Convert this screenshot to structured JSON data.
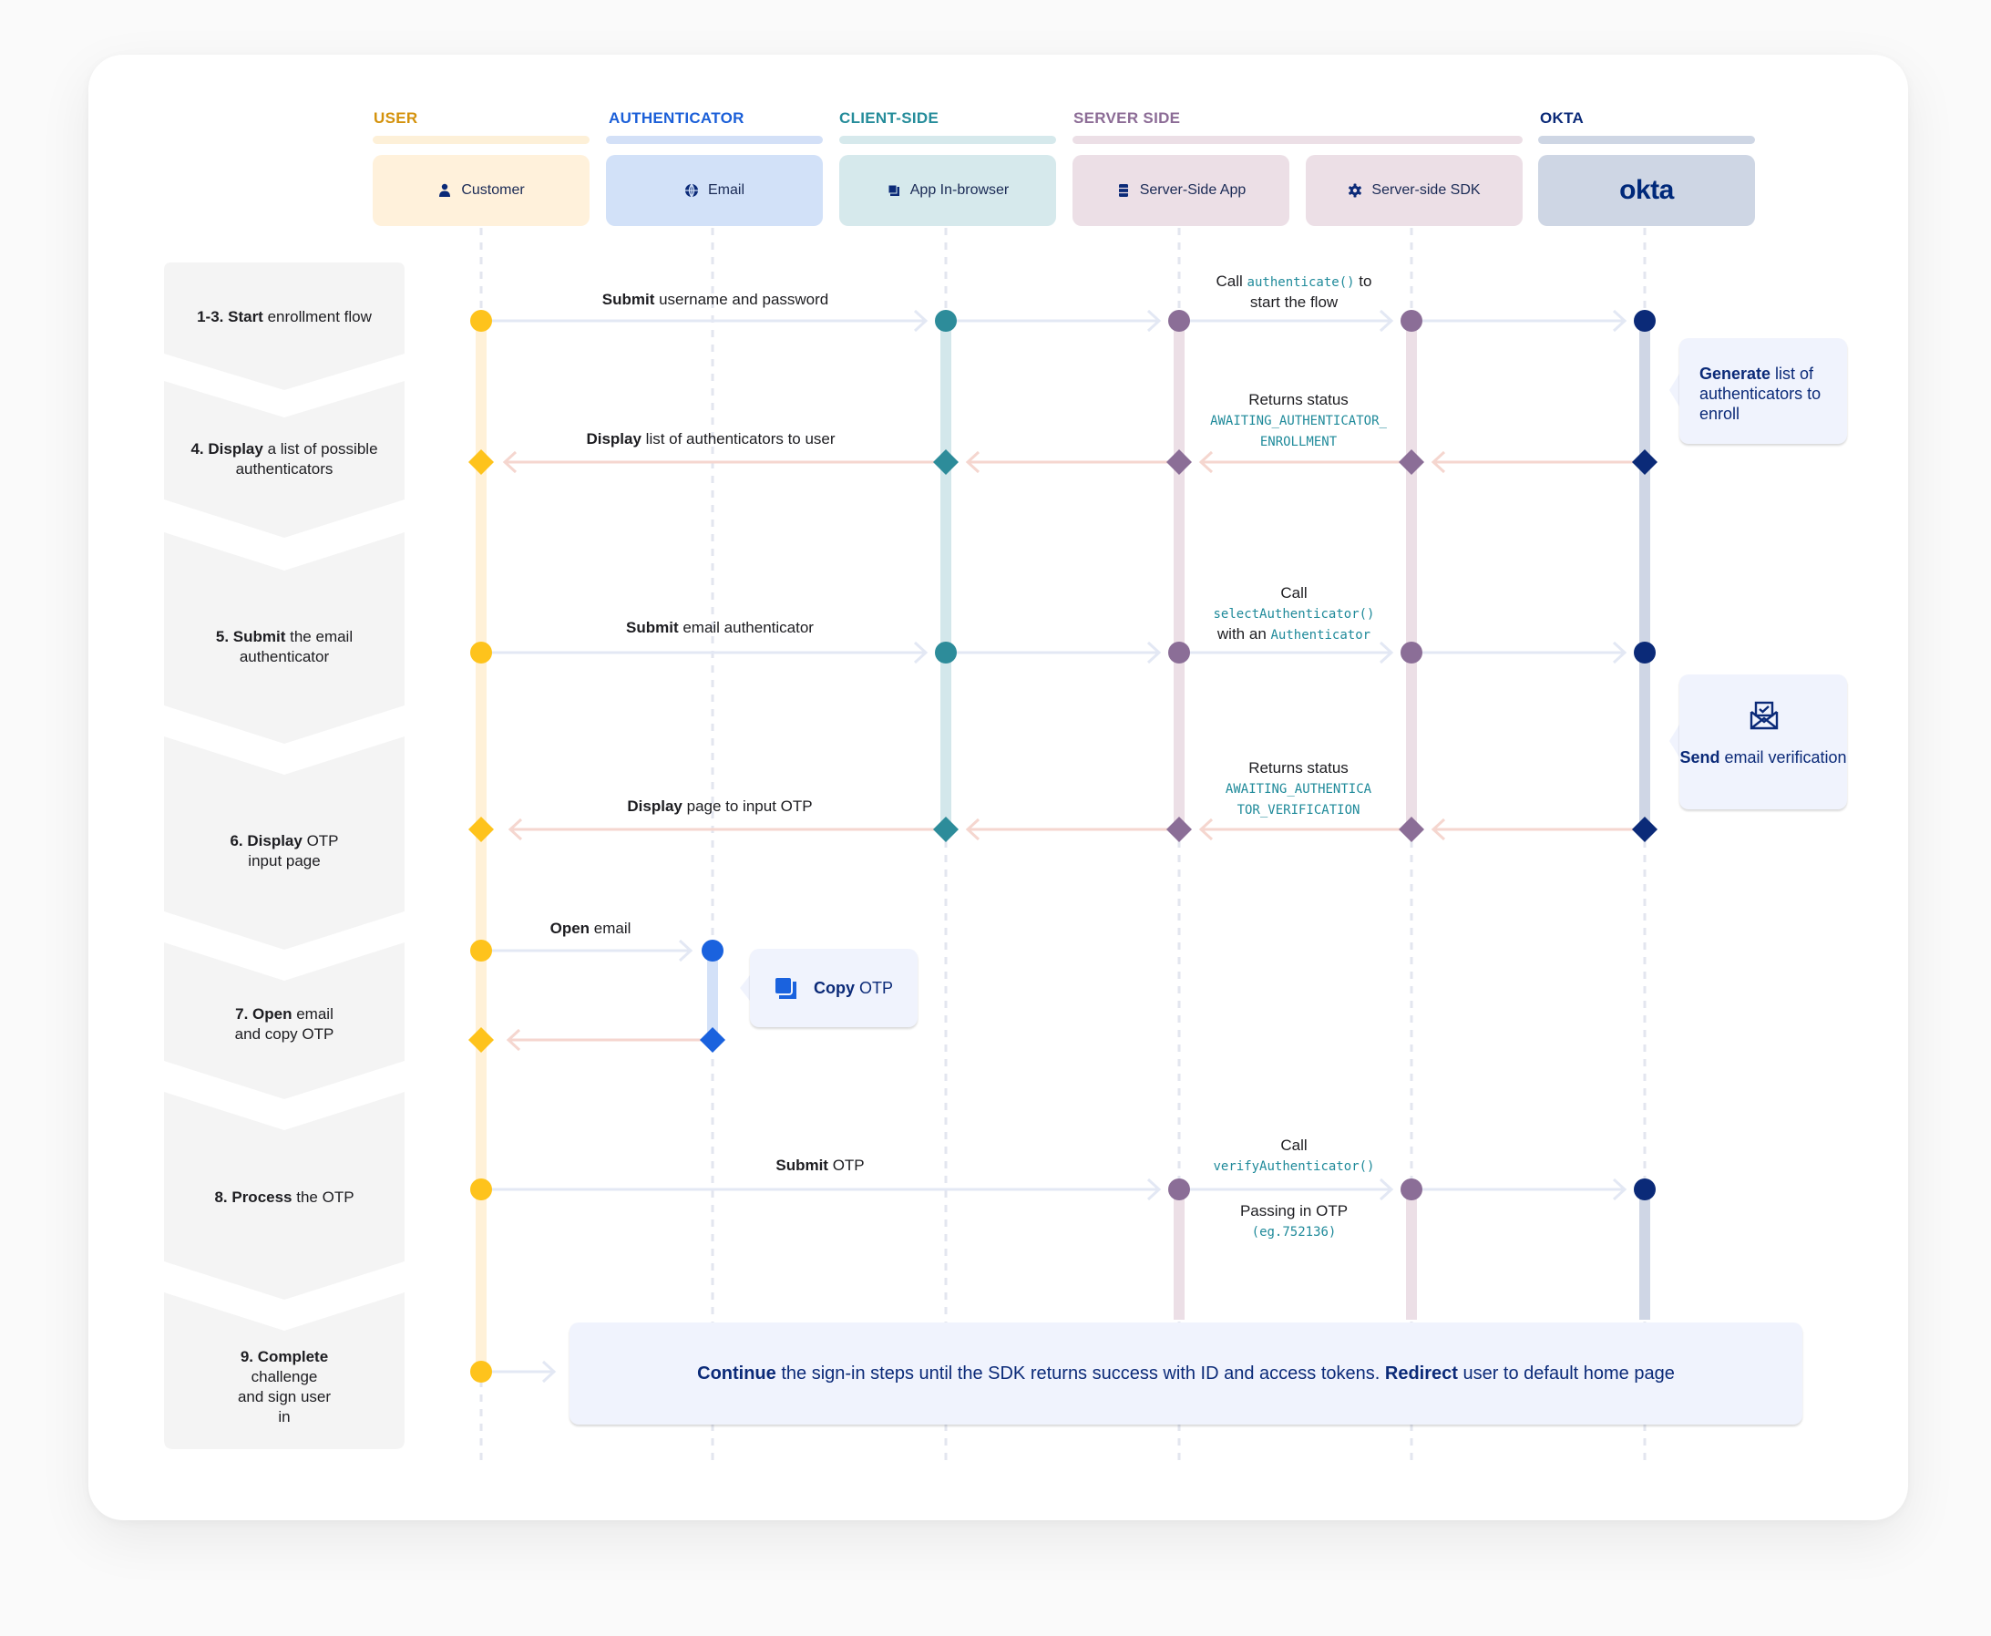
{
  "groups": [
    {
      "label": "USER",
      "color": "#d4920c",
      "bar": "#fdf0d8"
    },
    {
      "label": "AUTHENTICATOR",
      "color": "#1b5fd8",
      "bar": "#d3e0f7"
    },
    {
      "label": "CLIENT-SIDE",
      "color": "#258c9a",
      "bar": "#d6e9ec"
    },
    {
      "label": "SERVER SIDE",
      "color": "#8c6c96",
      "bar": "#ecdfe6"
    },
    {
      "label": "OKTA",
      "color": "#0b2a78",
      "bar": "#ced6e4"
    }
  ],
  "actors": [
    {
      "label": "Customer",
      "icon": "user-icon",
      "bg": "#fff1db"
    },
    {
      "label": "Email",
      "icon": "globe-icon",
      "bg": "#d2e1f8"
    },
    {
      "label": "App In-browser",
      "icon": "browser-windows-icon",
      "bg": "#d6e9ec"
    },
    {
      "label": "Server-Side App",
      "icon": "server-icon",
      "bg": "#ecdfe6"
    },
    {
      "label": "Server-side SDK",
      "icon": "gear-icon",
      "bg": "#ecdfe6"
    },
    {
      "label": "okta",
      "icon": "okta-logo",
      "bg": "#ced6e4"
    }
  ],
  "colors": {
    "user": "#fec31c",
    "user_track": "#fff1d8",
    "authenticator": "#1a62de",
    "authenticator_track": "#d3e1f8",
    "client": "#2d8c9a",
    "client_track": "#d3e7eb",
    "server": "#8b6e97",
    "server_track": "#ecdfe6",
    "okta": "#0b2a78",
    "okta_track": "#cfd6e5",
    "request_arrow": "#e3e8f4",
    "response_arrow": "#f5d6cf",
    "lifeline": "#e3e6ef"
  },
  "steps": [
    {
      "bold": "1-3. Start",
      "rest": " enrollment flow"
    },
    {
      "bold": "4. Display",
      "rest": " a list of possible authenticators"
    },
    {
      "bold": "5. Submit",
      "rest": " the email authenticator"
    },
    {
      "bold": "6. Display",
      "rest": " OTP input page"
    },
    {
      "bold": "7. Open",
      "rest": " email and copy OTP"
    },
    {
      "bold": "8. Process",
      "rest": " the OTP"
    },
    {
      "bold": "9. Complete",
      "rest": " challenge and sign user in"
    }
  ],
  "messages": {
    "m1": {
      "bold": "Submit",
      "rest": " username and password"
    },
    "m1b": {
      "pre": "Call ",
      "code": "authenticate()",
      "post": " to",
      "line2": "start the flow"
    },
    "m2": {
      "bold": "Display",
      "rest": " list of authenticators to user"
    },
    "m2b": {
      "line1": "Returns status",
      "code1": "AWAITING_AUTHENTICATOR_",
      "code2": "ENROLLMENT"
    },
    "m3": {
      "bold": "Submit",
      "rest": " email authenticator"
    },
    "m3b": {
      "line1": "Call",
      "code1": "selectAuthenticator()",
      "pre2": "with an ",
      "code2": "Authenticator"
    },
    "m4": {
      "bold": "Display",
      "rest": " page to input OTP"
    },
    "m4b": {
      "line1": "Returns status",
      "code1": "AWAITING_AUTHENTICA",
      "code2": "TOR_VERIFICATION"
    },
    "m5": {
      "bold": "Open",
      "rest": " email"
    },
    "m6": {
      "bold": "Submit",
      "rest": " OTP"
    },
    "m6b": {
      "line1": "Call",
      "code1": "verifyAuthenticator()",
      "line2": "Passing in OTP",
      "code2": "(eg.752136)"
    }
  },
  "notes": {
    "generate": {
      "bold": "Generate",
      "rest": " list of authenticators to enroll"
    },
    "send": {
      "bold": "Send",
      "rest": " email verification",
      "icon": "email-check-icon"
    },
    "copy": {
      "bold": "Copy",
      "rest": " OTP",
      "icon": "copy-icon"
    }
  },
  "final": {
    "bold1": "Continue",
    "text1": " the sign-in steps until the SDK returns success with ID and access tokens. ",
    "bold2": "Redirect",
    "text2": " user to default home page"
  }
}
